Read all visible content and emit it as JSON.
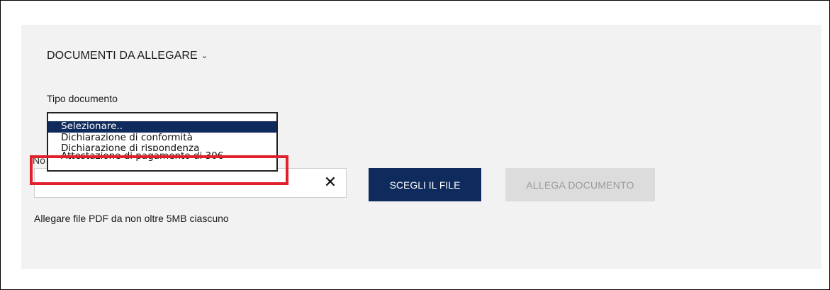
{
  "section": {
    "title": "DOCUMENTI DA ALLEGARE",
    "chevron": "⌄"
  },
  "document_type": {
    "label": "Tipo documento",
    "options": [
      "Selezionare..",
      "Dichiarazione di conformità",
      "Dichiarazione di rispondenza",
      "Attestazione di pagamento di 30€"
    ],
    "selected_index": 0
  },
  "file_name": {
    "partial_label": "No",
    "value": "",
    "clear_symbol": "✕"
  },
  "buttons": {
    "choose_file": "SCEGLI IL FILE",
    "attach_document": "ALLEGA DOCUMENTO"
  },
  "hint": "Allegare file PDF da non oltre 5MB ciascuno",
  "colors": {
    "primary": "#0f2a5c",
    "panel_bg": "#f2f2f2",
    "disabled_bg": "#dcdcdc",
    "disabled_text": "#9a9a9a",
    "highlight": "#e0202a"
  }
}
